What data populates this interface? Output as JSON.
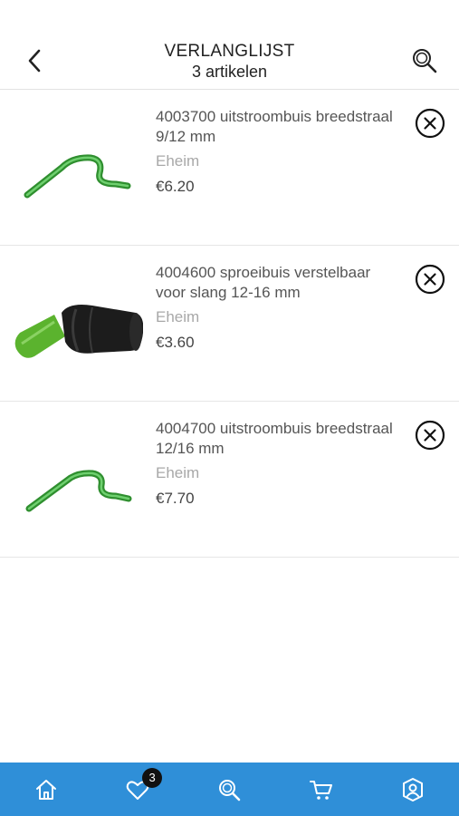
{
  "header": {
    "title": "VERLANGLIJST",
    "subtitle": "3 artikelen",
    "back_icon": "chevron-left-icon",
    "search_icon": "search-icon"
  },
  "items": [
    {
      "name": "4003700 uitstroombuis breedstraal 9/12 mm",
      "brand": "Eheim",
      "price": "€6.20",
      "image": "green-outflow-pipe"
    },
    {
      "name": "4004600 sproeibuis verstelbaar voor slang 12-16 mm",
      "brand": "Eheim",
      "price": "€3.60",
      "image": "green-black-spray-nozzle"
    },
    {
      "name": "4004700 uitstroombuis breedstraal 12/16 mm",
      "brand": "Eheim",
      "price": "€7.70",
      "image": "green-outflow-pipe"
    }
  ],
  "tabbar": {
    "tabs": [
      "home-icon",
      "heart-icon",
      "search-icon",
      "cart-icon",
      "account-icon"
    ],
    "wishlist_badge": "3"
  },
  "colors": {
    "tabbar": "#2f8fd8",
    "product_green": "#3aa33a",
    "badge": "#111111"
  }
}
